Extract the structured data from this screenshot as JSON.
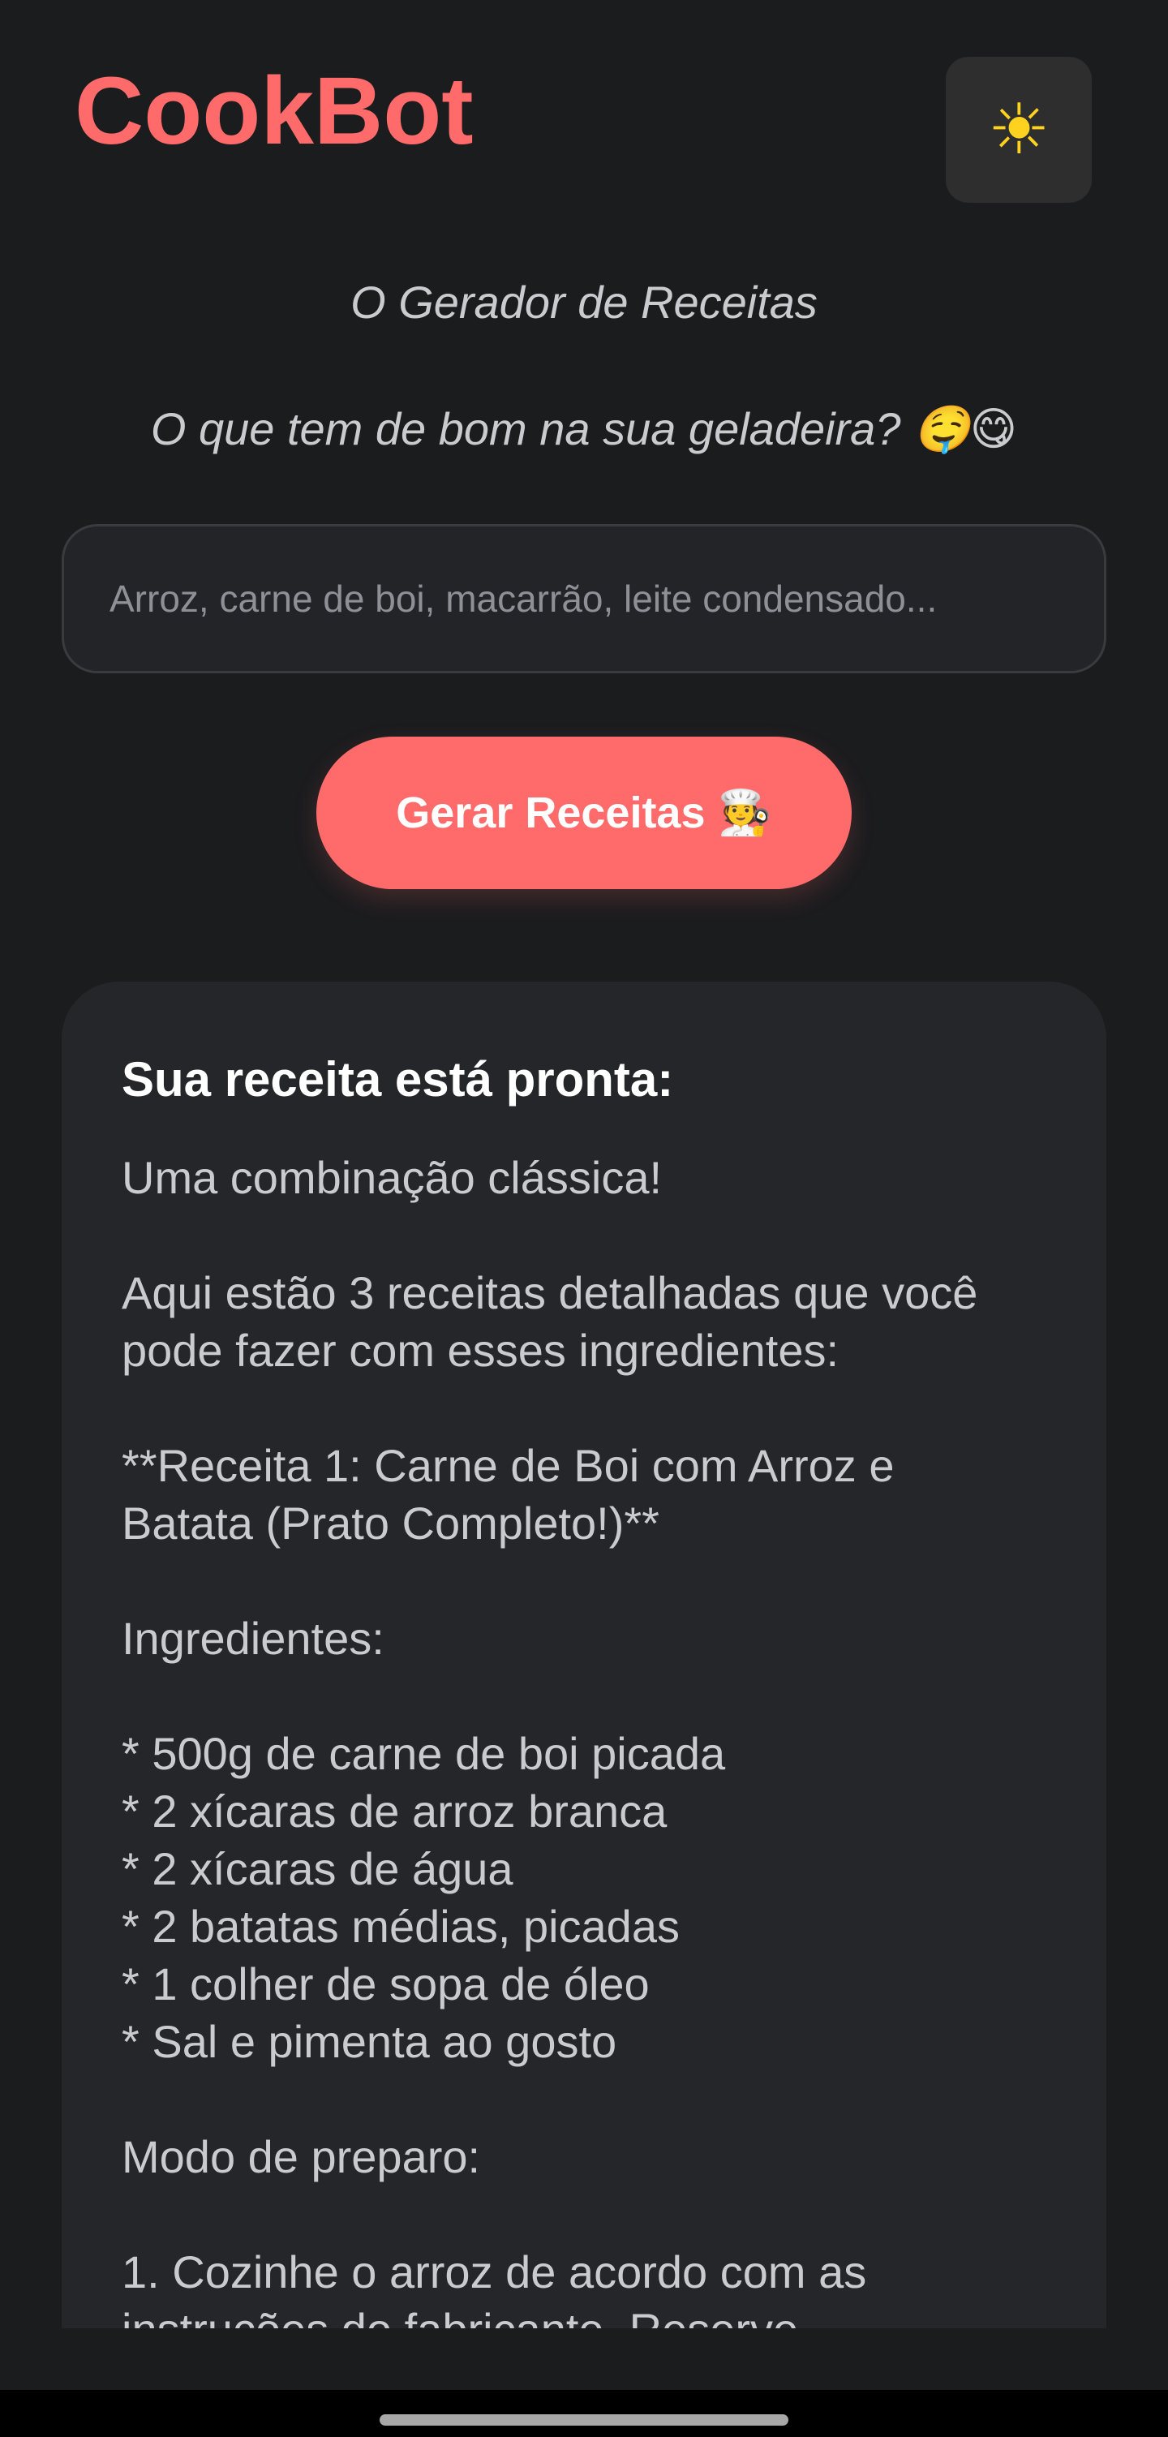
{
  "header": {
    "logo": "CookBot",
    "theme_icon": "sun-icon",
    "theme_glyph": "☀"
  },
  "hero": {
    "subtitle": "O Gerador de Receitas",
    "question": "O que tem de bom na sua geladeira? 🤤😋"
  },
  "search": {
    "placeholder": "Arroz, carne de boi, macarrão, leite condensado...",
    "value": ""
  },
  "actions": {
    "generate_label": "Gerar Receitas 🧑‍🍳"
  },
  "result": {
    "title": "Sua receita está pronta:",
    "lines": [
      "Uma combinação clássica!",
      "",
      "Aqui estão 3 receitas detalhadas que você",
      "pode fazer com esses ingredientes:",
      "",
      "**Receita 1: Carne de Boi com Arroz e",
      "Batata (Prato Completo!)**",
      "",
      "Ingredientes:",
      "",
      "* 500g de carne de boi picada",
      "* 2 xícaras de arroz branca",
      "* 2 xícaras de água",
      "* 2 batatas médias, picadas",
      "* 1 colher de sopa de óleo",
      "* Sal e pimenta ao gosto",
      "",
      "Modo de preparo:",
      "",
      "1. Cozinhe o arroz de acordo com as",
      "instruções do fabricante. Reserve."
    ]
  },
  "colors": {
    "background": "#1b1c1e",
    "accent": "#ff6b6b",
    "card": "#252629",
    "sun": "#ffd21f"
  }
}
